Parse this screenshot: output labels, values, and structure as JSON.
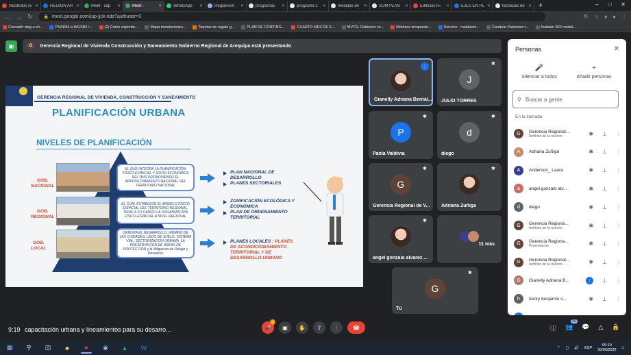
{
  "browser": {
    "tabs": [
      {
        "label": "Recibidos (6",
        "color": "#ea4335"
      },
      {
        "label": "REGION AR",
        "color": "#1a73e8"
      },
      {
        "label": "Meet - cap",
        "color": "#34a853"
      },
      {
        "label": "Meet -",
        "color": "#34a853",
        "active": true
      },
      {
        "label": "WhatsApp",
        "color": "#25d366"
      },
      {
        "label": "Reglament",
        "color": "#8ab4f8"
      },
      {
        "label": "programac",
        "color": "#e8eaed"
      },
      {
        "label": "programa c",
        "color": "#e8eaed"
      },
      {
        "label": "medidas de",
        "color": "#e8eaed"
      },
      {
        "label": "SUM PLAN",
        "color": "#e8eaed"
      },
      {
        "label": "Edificios Hi",
        "color": "#ea4335"
      },
      {
        "label": "EJES EN PL",
        "color": "#1a73e8"
      },
      {
        "label": "fachadas de",
        "color": "#e8eaed"
      }
    ],
    "url": "meet.google.com/jup-jjck-ndz?authuser=3",
    "bookmarks": [
      {
        "label": "Convertir dwg a sh...",
        "color": "#ea4335"
      },
      {
        "label": "PSAD56 a WGS84 /...",
        "color": "#1a73e8"
      },
      {
        "label": "(2) Como exportar...",
        "color": "#ea4335"
      },
      {
        "label": "Mapa Instalaciones...",
        "color": "#5f6368"
      },
      {
        "label": "Tarjetas de regalo g...",
        "color": "#e37400"
      },
      {
        "label": "PLAN DE CONTING...",
        "color": "#5f6368"
      },
      {
        "label": "CUARTO MES DE E...",
        "color": "#ea4335"
      },
      {
        "label": "MVCS: Gobierno co...",
        "color": "#5f6368"
      },
      {
        "label": "Módulos temporale...",
        "color": "#ea4335"
      },
      {
        "label": "Sencico - Instalació...",
        "color": "#1a73e8"
      },
      {
        "label": "Caratula Viviendas t...",
        "color": "#5f6368"
      },
      {
        "label": "Instalan 302 módul...",
        "color": "#5f6368"
      }
    ]
  },
  "meet": {
    "presenting_text": "Gerencia Regional de Vivienda Construcción y Saneamiento Gobierno Regional de Arequipa está presentando",
    "presenter_initial": "G",
    "time": "9:19",
    "meeting_name": "capacitación urbana y lineamientos para su desarro...",
    "people_count": "20",
    "raise_count": "1"
  },
  "slide": {
    "header": "GERENCIA REGIONAL DE VIVIENDA, CONSTRUCCIÓN Y SANEAMIENTO",
    "title": "PLANIFICACIÓN URBANA",
    "subtitle": "NIVELES DE PLANIFICACIÓN",
    "levels": [
      {
        "name_line1": "GOB.",
        "name_line2": "NACIONAL",
        "box": "EL QUE INTEGRA LA PLANIFICACIÓN FÍSICO-ESPACIAL Y SOCIO ECONÓMICA DEL PAÍS PROMOVIENDO EL APROVECHAMIENTO RACIONAL DEL TERRITORIO NACIONAL",
        "bullets": [
          "PLAN NACIONAL DE DESARROLLO",
          "PLANES SECTORIALES"
        ]
      },
      {
        "name_line1": "GOB.",
        "name_line2": "REGIONAL",
        "box": "EL CUAL ESTABLECE EL MODELO FÍSICO ESPACIAL DEL TERRITORIO REGIONAL, TIENE A SU CARGO LA ORGANIZACIÓN FÍSICO-ESPACIAL A NIVEL REGIONAL",
        "bullets": [
          "ZONIFICACIÓN ECOLÓGICA Y ECONÓMICA",
          "PLAN DE ORDENAMIENTO TERRITORIAL"
        ]
      },
      {
        "name_line1": "GOB.",
        "name_line2": "LOCAL",
        "box": "ORIENTA EL DESARROLLO URBANO DE LAS CIUDADES, USOS DE SUELO, SISTEMA VIAL, SECTORIZACIÓN URBANA, LA PRESERVACIÓN DE ÁREAS DE PROTECCIÓN y la Mitigación de Riesgo y Desastres",
        "bullets_black": "PLANES LOCALES : ",
        "bullets_red": "PLANES DE ACONDICIONAMIENTO TERRITORIAL Y DE DESARROLLO URBANO"
      }
    ]
  },
  "tiles": [
    {
      "name": "Gianelly Adriana Bernal...",
      "type": "photo",
      "speaking": true
    },
    {
      "name": "JULIO TORRES",
      "initial": "J",
      "color": "#5f6368"
    },
    {
      "name": "Paola Valdivia",
      "initial": "P",
      "color": "#1a73e8"
    },
    {
      "name": "diego",
      "initial": "d",
      "color": "#5f6368"
    },
    {
      "name": "Gerencia Regional de V...",
      "initial": "G",
      "color": "#5f4336"
    },
    {
      "name": "Adriana Zuñiga",
      "type": "photo"
    },
    {
      "name": "angel gonzalo alvarez ...",
      "type": "photo"
    },
    {
      "name": "11 más",
      "type": "more"
    },
    {
      "name": "Tú",
      "initial": "G",
      "color": "#5f4336"
    }
  ],
  "panel": {
    "title": "Personas",
    "mute_all": "Silenciar a todos",
    "add_people": "Añadir personas",
    "search_placeholder": "Buscar a gente",
    "section": "En la llamada",
    "people": [
      {
        "name": "Gerencia Regional de... (Tú)",
        "sub": "Anfitrión de la reunión",
        "initial": "G",
        "color": "#5f4336"
      },
      {
        "name": "Adriana Zuñiga",
        "sub": "",
        "initial": "A",
        "color": "#c58a6a"
      },
      {
        "name": "Anderson_ Laura",
        "sub": "",
        "initial": "A",
        "color": "#3a3f8c"
      },
      {
        "name": "angel gonzalo alv...",
        "sub": "",
        "initial": "a",
        "color": "#c96b6b"
      },
      {
        "name": "diego",
        "sub": "",
        "initial": "d",
        "color": "#5f6368"
      },
      {
        "name": "Gerencia Regiona...",
        "sub": "Anfitrión de la reunión",
        "initial": "G",
        "color": "#5f4336"
      },
      {
        "name": "Gerencia Regiona...",
        "sub": "Presentación",
        "initial": "G",
        "color": "#5f4336"
      },
      {
        "name": "Gerencia Regional de Vivi...",
        "sub": "Anfitrión de la reunión · Modo...",
        "initial": "G",
        "color": "#5f4336"
      },
      {
        "name": "Gianelly Adriana B...",
        "sub": "",
        "initial": "G",
        "color": "#b07a6a",
        "speaking": true
      },
      {
        "name": "henry benjamin s...",
        "sub": "",
        "initial": "h",
        "color": "#5f6368"
      },
      {
        "name": "henry Nixon Cruz...",
        "sub": "",
        "initial": "h",
        "color": "#1a73e8"
      }
    ]
  },
  "taskbar": {
    "time": "09:19",
    "date": "30/06/2022",
    "lang": "ESP"
  }
}
